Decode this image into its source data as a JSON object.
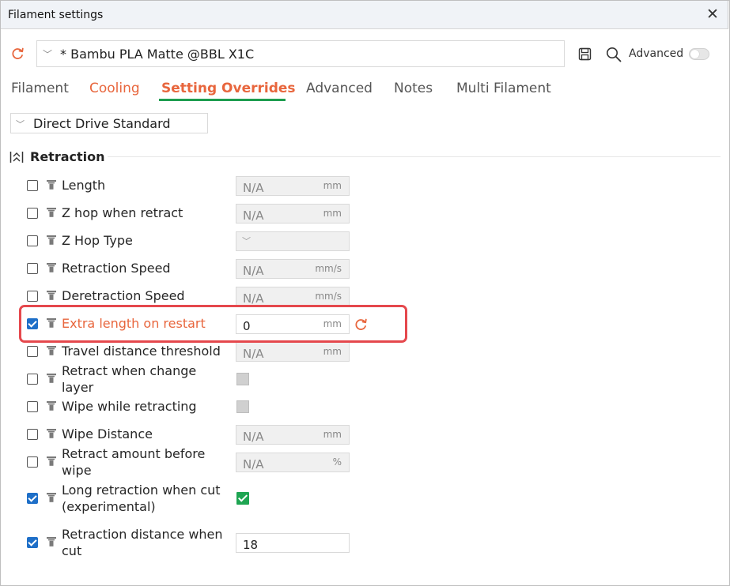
{
  "window": {
    "title": "Filament settings",
    "close_symbol": "✕"
  },
  "preset": {
    "name": "* Bambu PLA Matte @BBL X1C",
    "advanced_label": "Advanced",
    "advanced_enabled": false
  },
  "tabs": [
    {
      "label": "Filament",
      "state": "normal"
    },
    {
      "label": "Cooling",
      "state": "modified"
    },
    {
      "label": "Setting Overrides",
      "state": "active"
    },
    {
      "label": "Advanced",
      "state": "normal"
    },
    {
      "label": "Notes",
      "state": "normal"
    },
    {
      "label": "Multi Filament",
      "state": "normal"
    }
  ],
  "extruder_profile": "Direct Drive Standard",
  "section": {
    "title": "Retraction"
  },
  "rows": [
    {
      "label": "Length",
      "checked": false,
      "kind": "text",
      "value": "N/A",
      "unit": "mm"
    },
    {
      "label": "Z hop when retract",
      "checked": false,
      "kind": "text",
      "value": "N/A",
      "unit": "mm"
    },
    {
      "label": "Z Hop Type",
      "checked": false,
      "kind": "select",
      "value": "",
      "unit": ""
    },
    {
      "label": "Retraction Speed",
      "checked": false,
      "kind": "text",
      "value": "N/A",
      "unit": "mm/s"
    },
    {
      "label": "Deretraction Speed",
      "checked": false,
      "kind": "text",
      "value": "N/A",
      "unit": "mm/s"
    },
    {
      "label": "Extra length on restart",
      "checked": true,
      "kind": "text",
      "value": "0",
      "unit": "mm",
      "highlighted": true
    },
    {
      "label": "Travel distance threshold",
      "checked": false,
      "kind": "text",
      "value": "N/A",
      "unit": "mm"
    },
    {
      "label": "Retract when change layer",
      "checked": false,
      "kind": "bool",
      "value": false
    },
    {
      "label": "Wipe while retracting",
      "checked": false,
      "kind": "bool",
      "value": false
    },
    {
      "label": "Wipe Distance",
      "checked": false,
      "kind": "text",
      "value": "N/A",
      "unit": "mm"
    },
    {
      "label": "Retract amount before wipe",
      "checked": false,
      "kind": "text",
      "value": "N/A",
      "unit": "%"
    },
    {
      "label": "Long retraction when cut (experimental)",
      "checked": true,
      "kind": "bool",
      "value": true
    },
    {
      "label": "Retraction distance when cut",
      "checked": true,
      "kind": "text",
      "value": "18",
      "unit": ""
    }
  ],
  "colors": {
    "accent_orange": "#e8663d",
    "tab_underline_green": "#1d9d4f",
    "checkbox_blue": "#1e6fc8",
    "highlight_red": "#e5484d",
    "bool_green": "#1ea552"
  }
}
